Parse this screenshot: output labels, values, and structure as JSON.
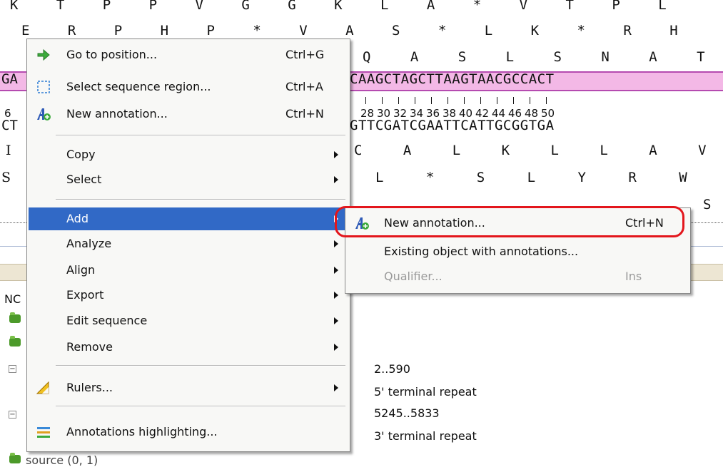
{
  "sequence_view": {
    "row_top": "K T P P V G G K L A * V T P L",
    "row_frame2": "E R P H P * V A S * L K * R H",
    "row_frame3_visible": "Q A S L S N A T",
    "selected_dna_left": "GA",
    "selected_dna": "CAAGCTAGCTTAAGTAACGCCACT",
    "ruler_left": "6",
    "ruler_numbers": [
      "28",
      "30",
      "32",
      "34",
      "36",
      "38",
      "40",
      "42",
      "44",
      "46",
      "48",
      "50"
    ],
    "complement_left": "CT",
    "complement_dna": "GTTCGATCGAATTCATTGCGGTGA",
    "rev_frame1_left": "I",
    "rev_frame1": "C A L K L L A V",
    "rev_frame2_left": "S",
    "rev_frame2": "L * S L Y R W K",
    "rev_frame3_visible": "S"
  },
  "annotations_panel": {
    "left_label": "NC",
    "entries": [
      "2..590",
      "5' terminal repeat",
      "5245..5833",
      "3' terminal repeat"
    ],
    "bottom_item": "source (0, 1)"
  },
  "context_menu": {
    "items": [
      {
        "label": "Go to position...",
        "shortcut": "Ctrl+G",
        "icon": "arrow-right-icon"
      },
      {
        "label": "Select sequence region...",
        "shortcut": "Ctrl+A",
        "icon": "select-region-icon"
      },
      {
        "label": "New annotation...",
        "shortcut": "Ctrl+N",
        "icon": "new-annotation-icon"
      },
      {
        "label": "Copy"
      },
      {
        "label": "Select"
      },
      {
        "label": "Add"
      },
      {
        "label": "Analyze"
      },
      {
        "label": "Align"
      },
      {
        "label": "Export"
      },
      {
        "label": "Edit sequence"
      },
      {
        "label": "Remove"
      },
      {
        "label": "Rulers...",
        "icon": "ruler-icon"
      },
      {
        "label": "Annotations highlighting...",
        "icon": "highlight-icon"
      }
    ]
  },
  "submenu_add": {
    "items": [
      {
        "label": "New annotation...",
        "shortcut": "Ctrl+N",
        "icon": "new-annotation-icon",
        "enabled": true
      },
      {
        "label": "Existing object with annotations...",
        "enabled": true
      },
      {
        "label": "Qualifier...",
        "shortcut": "Ins",
        "enabled": false
      }
    ]
  },
  "colors": {
    "highlight": "#3169c6",
    "selection_band": "#f3b8e6",
    "callout_ring": "#e3161c"
  }
}
